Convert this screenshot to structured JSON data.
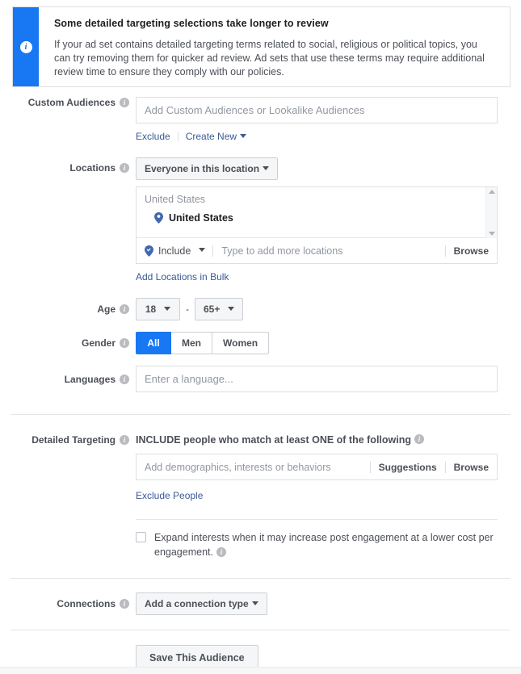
{
  "banner": {
    "icon": "info-circle-icon",
    "accent_color": "#1877f2",
    "title": "Some detailed targeting selections take longer to review",
    "text": "If your ad set contains detailed targeting terms related to social, religious or political topics, you can try removing them for quicker ad review. Ad sets that use these terms may require additional review time to ensure they comply with our policies."
  },
  "custom_audiences": {
    "label": "Custom Audiences",
    "placeholder": "Add Custom Audiences or Lookalike Audiences",
    "value": "",
    "exclude_link": "Exclude",
    "create_new_link": "Create New"
  },
  "locations": {
    "label": "Locations",
    "scope_dropdown": "Everyone in this location",
    "country_group": "United States",
    "selected": [
      {
        "name": "United States",
        "icon": "map-pin-icon"
      }
    ],
    "include_dropdown": "Include",
    "input_placeholder": "Type to add more locations",
    "browse_label": "Browse",
    "bulk_link": "Add Locations in Bulk"
  },
  "age": {
    "label": "Age",
    "min": "18",
    "max": "65+",
    "separator": "-"
  },
  "gender": {
    "label": "Gender",
    "options": [
      "All",
      "Men",
      "Women"
    ],
    "selected": "All",
    "active_color": "#1877f2"
  },
  "languages": {
    "label": "Languages",
    "placeholder": "Enter a language...",
    "value": ""
  },
  "detailed_targeting": {
    "label": "Detailed Targeting",
    "include_heading": "INCLUDE people who match at least ONE of the following",
    "placeholder": "Add demographics, interests or behaviors",
    "suggestions_label": "Suggestions",
    "browse_label": "Browse",
    "exclude_link": "Exclude People",
    "expand_checkbox": {
      "checked": false,
      "label": "Expand interests when it may increase post engagement at a lower cost per engagement."
    }
  },
  "connections": {
    "label": "Connections",
    "dropdown": "Add a connection type"
  },
  "save": {
    "label": "Save This Audience"
  },
  "link_color": "#3b5998"
}
